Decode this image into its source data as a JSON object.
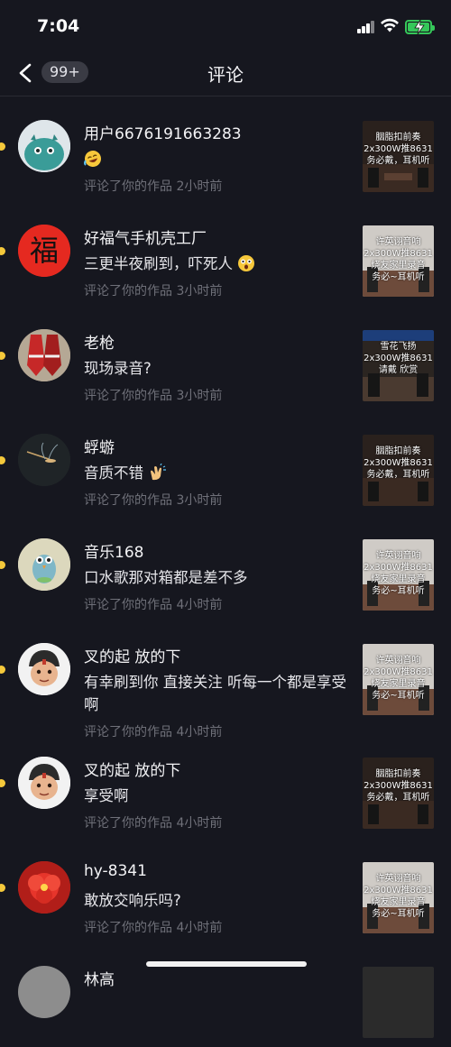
{
  "status_bar": {
    "time": "7:04"
  },
  "nav": {
    "badge": "99+",
    "title": "评论"
  },
  "comments": [
    {
      "user": "用户6676191663283",
      "text": "",
      "emoji": "laughing-face",
      "meta": "评论了你的作品  2小时前",
      "thumb_text": "胭脂扣前奏\n2x300W推8631\n务必戴，耳机听"
    },
    {
      "user": "好福气手机壳工厂",
      "text": "三更半夜刷到，吓死人",
      "emoji": "shocked-face",
      "meta": "评论了你的作品  3小时前",
      "avatar_char": "福",
      "thumb_text": "许英诩音响\n2x300W推8631\n烧友家里录音\n务必~耳机听"
    },
    {
      "user": "老枪",
      "text": "现场录音?",
      "meta": "评论了你的作品  3小时前",
      "thumb_text": "雪花飞扬\n2x300W推8631\n请戴  欣赏"
    },
    {
      "user": "蜉蝣",
      "text": "音质不错",
      "emoji": "clap",
      "meta": "评论了你的作品  3小时前",
      "thumb_text": "胭脂扣前奏\n2x300W推8631\n务必戴，耳机听"
    },
    {
      "user": "音乐168",
      "text": "口水歌那对箱都是差不多",
      "meta": "评论了你的作品  4小时前",
      "thumb_text": "许英诩音响\n2x300W推8631\n烧友家里录音\n务必~耳机听"
    },
    {
      "user": "叉的起 放的下",
      "text": "有幸刷到你 直接关注 听每一个都是享受啊",
      "meta": "评论了你的作品  4小时前",
      "thumb_text": "许英诩音响\n2x300W推8631\n烧友家里录音\n务必~耳机听"
    },
    {
      "user": "叉的起 放的下",
      "text": "享受啊",
      "meta": "评论了你的作品  4小时前",
      "thumb_text": "胭脂扣前奏\n2x300W推8631\n务必戴，耳机听"
    },
    {
      "user": "hy-8341",
      "text": "敢放交响乐吗?",
      "meta": "评论了你的作品  4小时前",
      "thumb_text": "许英诩音响\n2x300W推8631\n烧友家里录音\n务必~耳机听"
    },
    {
      "user": "林高",
      "text": "",
      "meta": "",
      "thumb_text": ""
    }
  ],
  "colors": {
    "background": "#16171f",
    "unread_dot": "#f5c93b",
    "meta": "#6f7079",
    "battery": "#35c759"
  }
}
